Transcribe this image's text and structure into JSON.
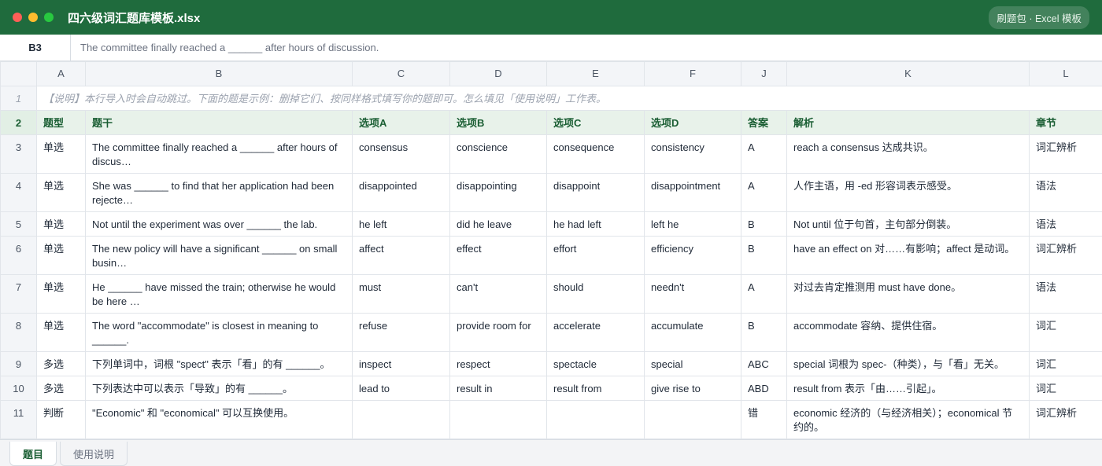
{
  "window": {
    "title": "四六级词汇题库模板.xlsx",
    "badge": "刷题包 · Excel 模板"
  },
  "formula_bar": {
    "cell_ref": "B3",
    "content": "The committee finally reached a ______ after hours of discussion."
  },
  "columns": [
    "A",
    "B",
    "C",
    "D",
    "E",
    "F",
    "J",
    "K",
    "L"
  ],
  "note_row": {
    "row": "1",
    "text": "【说明】本行导入时会自动跳过。下面的题是示例：删掉它们、按同样格式填写你的题即可。怎么填见「使用说明」工作表。"
  },
  "header_row": {
    "row": "2",
    "cells": [
      "题型",
      "题干",
      "选项A",
      "选项B",
      "选项C",
      "选项D",
      "答案",
      "解析",
      "章节"
    ]
  },
  "rows": [
    {
      "row": "3",
      "cells": [
        "单选",
        "The committee finally reached a ______ after hours of discus…",
        "consensus",
        "conscience",
        "consequence",
        "consistency",
        "A",
        "reach a consensus 达成共识。",
        "词汇辨析"
      ]
    },
    {
      "row": "4",
      "cells": [
        "单选",
        "She was ______ to find that her application had been rejecte…",
        "disappointed",
        "disappointing",
        "disappoint",
        "disappointment",
        "A",
        "人作主语，用 -ed 形容词表示感受。",
        "语法"
      ]
    },
    {
      "row": "5",
      "cells": [
        "单选",
        "Not until the experiment was over ______ the lab.",
        "he left",
        "did he leave",
        "he had left",
        "left he",
        "B",
        "Not until 位于句首，主句部分倒装。",
        "语法"
      ]
    },
    {
      "row": "6",
      "cells": [
        "单选",
        "The new policy will have a significant ______ on small busin…",
        "affect",
        "effect",
        "effort",
        "efficiency",
        "B",
        "have an effect on 对……有影响；affect 是动词。",
        "词汇辨析"
      ]
    },
    {
      "row": "7",
      "cells": [
        "单选",
        "He ______ have missed the train; otherwise he would be here …",
        "must",
        "can't",
        "should",
        "needn't",
        "A",
        "对过去肯定推测用 must have done。",
        "语法"
      ]
    },
    {
      "row": "8",
      "cells": [
        "单选",
        "The word \"accommodate\" is closest in meaning to ______.",
        "refuse",
        "provide room for",
        "accelerate",
        "accumulate",
        "B",
        "accommodate 容纳、提供住宿。",
        "词汇"
      ]
    },
    {
      "row": "9",
      "cells": [
        "多选",
        "下列单词中，词根 \"spect\" 表示「看」的有 ______。",
        "inspect",
        "respect",
        "spectacle",
        "special",
        "ABC",
        "special 词根为 spec-（种类），与「看」无关。",
        "词汇"
      ]
    },
    {
      "row": "10",
      "cells": [
        "多选",
        "下列表达中可以表示「导致」的有 ______。",
        "lead to",
        "result in",
        "result from",
        "give rise to",
        "ABD",
        "result from 表示「由……引起」。",
        "词汇"
      ]
    },
    {
      "row": "11",
      "cells": [
        "判断",
        "\"Economic\" 和 \"economical\" 可以互换使用。",
        "",
        "",
        "",
        "",
        "错",
        "economic 经济的（与经济相关）；economical 节约的。",
        "词汇辨析"
      ]
    }
  ],
  "sheet_tabs": [
    "题目",
    "使用说明"
  ],
  "colors": {
    "brand": "#1f6b3d",
    "header_fill": "#e8f2ea",
    "header_text": "#1a5e33"
  }
}
